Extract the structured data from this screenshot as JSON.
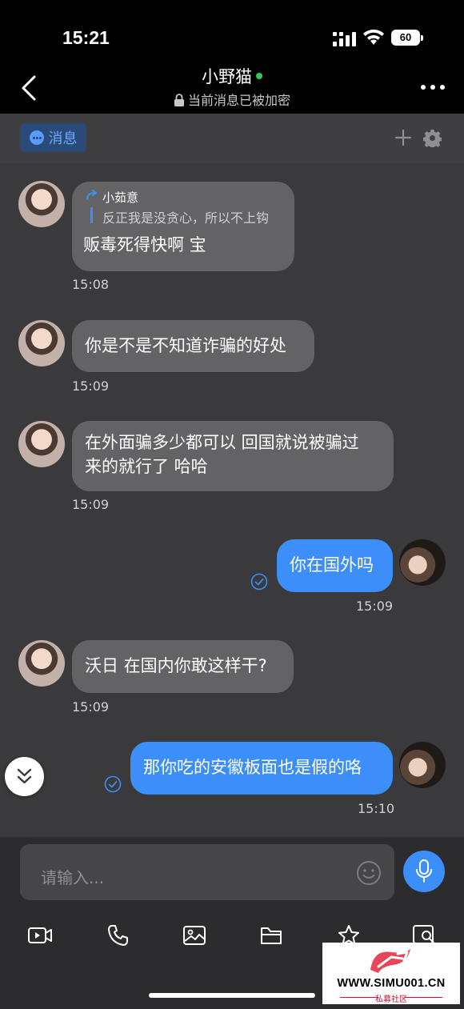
{
  "status_bar": {
    "time": "15:21",
    "battery": "60"
  },
  "nav": {
    "title": "小野猫",
    "subtitle": "当前消息已被加密"
  },
  "toolbar": {
    "tab_label": "消息"
  },
  "messages": [
    {
      "side": "in",
      "quote_name": "小茹意",
      "quote_text": "反正我是没贪心，所以不上钩",
      "text": "贩毒死得快啊 宝",
      "time": "15:08"
    },
    {
      "side": "in",
      "text": "你是不是不知道诈骗的好处",
      "time": "15:09"
    },
    {
      "side": "in",
      "line1": "在外面骗多少都可以 回国就说被骗过",
      "line2": "来的就行了 哈哈",
      "time": "15:09"
    },
    {
      "side": "out",
      "text": "你在国外吗",
      "time": "15:09"
    },
    {
      "side": "in",
      "text": "沃日 在国内你敢这样干?",
      "time": "15:09"
    },
    {
      "side": "out",
      "text": "那你吃的安徽板面也是假的咯",
      "time": "15:10"
    }
  ],
  "input": {
    "placeholder": "请输入..."
  },
  "watermark": {
    "main": "WWW.SIMU001.CN",
    "sub": "私募社区"
  },
  "colors": {
    "accent": "#3c8ef8",
    "online": "#35c759",
    "bubble_in": "#636366"
  }
}
